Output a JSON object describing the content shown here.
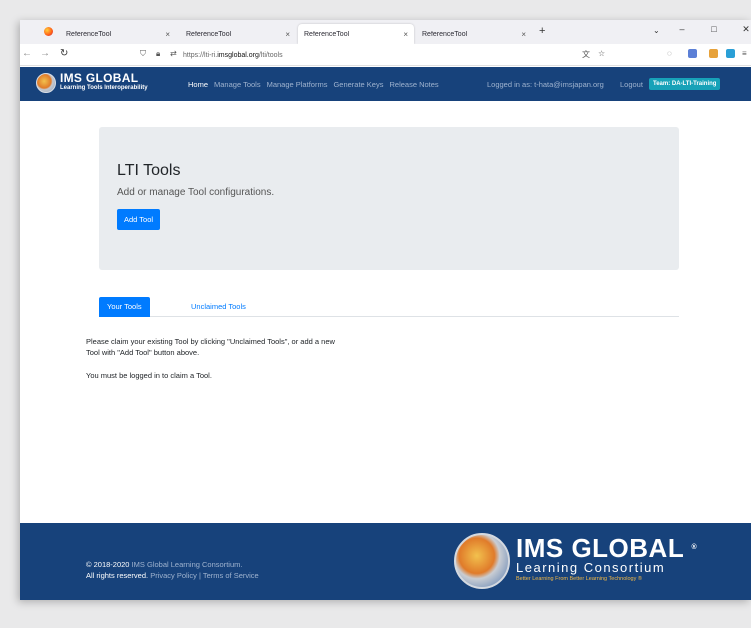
{
  "browser": {
    "tabs": [
      {
        "label": "ReferenceTool",
        "active": false
      },
      {
        "label": "ReferenceTool",
        "active": false
      },
      {
        "label": "ReferenceTool",
        "active": true
      },
      {
        "label": "ReferenceTool",
        "active": false
      }
    ],
    "close_glyph": "×",
    "new_tab_glyph": "+",
    "tab_list_glyph": "⌄",
    "window_controls": {
      "minimize": "–",
      "maximize": "□",
      "close": "✕"
    },
    "url_prefix": "https://lti-ri.",
    "url_domain": "imsglobal.org",
    "url_path": "/lti/tools"
  },
  "app": {
    "logo_title": "IMS GLOBAL",
    "logo_subtitle": "Learning Tools Interoperability",
    "nav": [
      {
        "label": "Home",
        "current": true
      },
      {
        "label": "Manage Tools",
        "current": false
      },
      {
        "label": "Manage Platforms",
        "current": false
      },
      {
        "label": "Generate Keys",
        "current": false
      },
      {
        "label": "Release Notes",
        "current": false
      }
    ],
    "login_text": "Logged in as: t-hata@imsjapan.org",
    "logout_label": "Logout",
    "team_badge": "Team: DA-LTI-Training"
  },
  "jumbotron": {
    "title": "LTI Tools",
    "lead": "Add or manage Tool configurations.",
    "add_button": "Add Tool"
  },
  "tools_tabs": [
    {
      "label": "Your Tools",
      "active": true
    },
    {
      "label": "Unclaimed Tools",
      "active": false
    }
  ],
  "messages": {
    "claim_line1": "Please claim your existing Tool by clicking \"Unclaimed Tools\", or add a new",
    "claim_line2": "Tool with \"Add Tool\" button above.",
    "login_required": "You must be logged in to claim a Tool."
  },
  "footer": {
    "copyright_prefix": "© 2018-2020 ",
    "copyright_org": "IMS Global Learning Consortium.",
    "rights_prefix": "All rights reserved. ",
    "privacy": "Privacy Policy",
    "separator": " | ",
    "terms": "Terms of Service",
    "brand_big": "IMS GLOBAL",
    "brand_reg": "®",
    "brand_mid": "Learning Consortium",
    "brand_tagline": "Better Learning From Better Learning Technology ®"
  },
  "colors": {
    "header_blue": "#17427b",
    "primary": "#007bff",
    "badge": "#17a2b8",
    "jumbotron": "#e9ecef"
  }
}
